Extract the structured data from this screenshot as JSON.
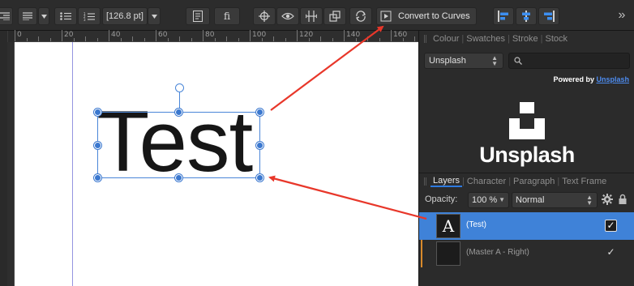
{
  "toolbar": {
    "font_size": "[126.8 pt]",
    "convert_to_curves_label": "Convert to Curves",
    "ligature_glyph": "fi"
  },
  "ruler": {
    "top_labels": [
      "0",
      "20",
      "40",
      "60",
      "80",
      "100",
      "120",
      "140",
      "160"
    ]
  },
  "canvas": {
    "text_content": "Test"
  },
  "swatch_panel": {
    "tabs": [
      "Colour",
      "Swatches",
      "Stroke",
      "Stock"
    ],
    "active_tab": "Stock",
    "source_select": "Unsplash",
    "search_placeholder": "",
    "powered_by_prefix": "Powered by",
    "powered_by_link": "Unsplash",
    "logo_text": "Unsplash"
  },
  "layers_panel": {
    "tabs": [
      "Layers",
      "Character",
      "Paragraph",
      "Text Frame"
    ],
    "active_tab": "Layers",
    "opacity_label": "Opacity:",
    "opacity_value": "100 %",
    "blend_mode": "Normal",
    "layers": [
      {
        "name": "(Test)",
        "thumb_glyph": "A",
        "visible": true,
        "selected": true
      },
      {
        "name": "(Master A - Right)",
        "thumb_glyph": "",
        "visible": true,
        "selected": false
      }
    ]
  },
  "colors": {
    "selection_accent": "#3b78cf",
    "annotation_arrow": "#e8372a",
    "layer_selected": "#3f82d8"
  }
}
